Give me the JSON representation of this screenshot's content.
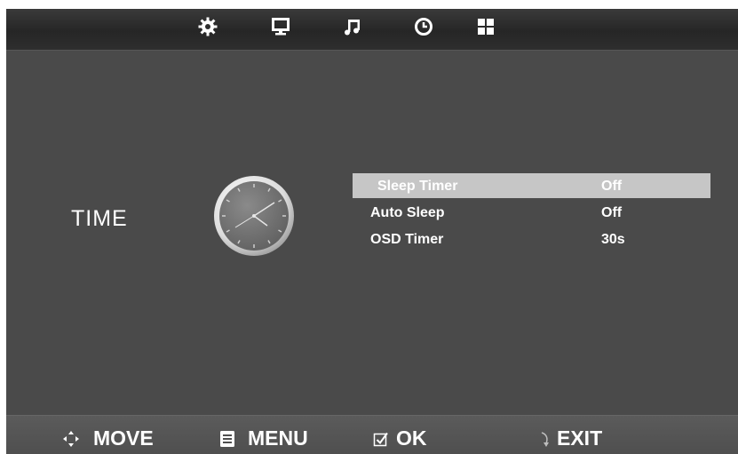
{
  "top_tabs": [
    {
      "icon": "gear-icon"
    },
    {
      "icon": "monitor-icon"
    },
    {
      "icon": "music-note-icon"
    },
    {
      "icon": "clock-icon"
    },
    {
      "icon": "grid-icon"
    }
  ],
  "section": {
    "title": "TIME",
    "icon": "clock-icon"
  },
  "menu": {
    "selected_index": 0,
    "items": [
      {
        "label": "Sleep Timer",
        "value": "Off"
      },
      {
        "label": "Auto Sleep",
        "value": "Off"
      },
      {
        "label": "OSD Timer",
        "value": "30s"
      }
    ]
  },
  "footer": {
    "move": "MOVE",
    "menu": "MENU",
    "ok": "OK",
    "exit": "EXIT"
  },
  "colors": {
    "background": "#4a4a4a",
    "highlight": "#c6c6c6",
    "text": "#ffffff"
  }
}
